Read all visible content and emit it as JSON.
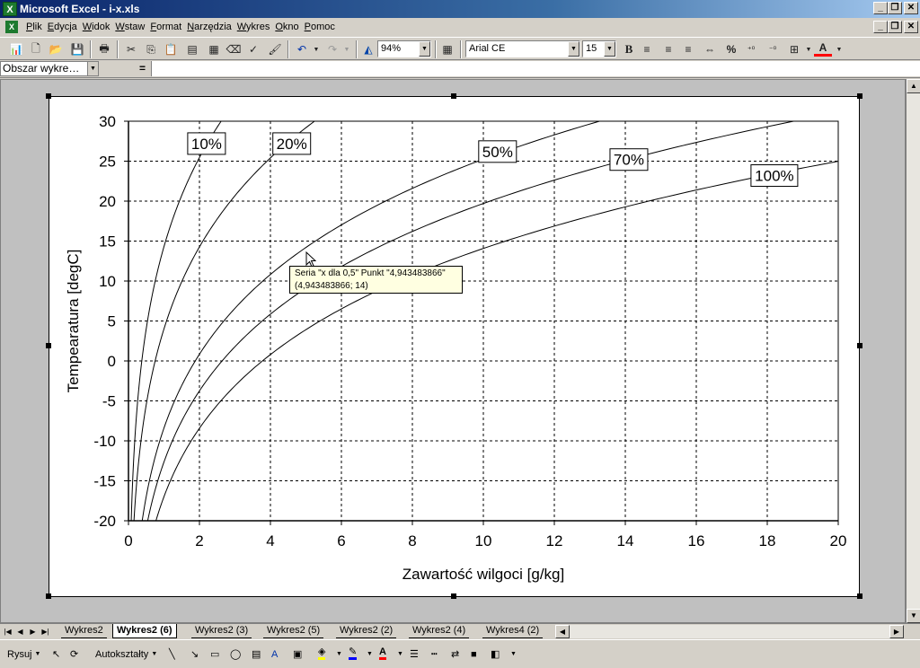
{
  "window": {
    "title": "Microsoft Excel - i-x.xls",
    "app_icon": "X"
  },
  "menu": [
    {
      "key": "P",
      "rest": "lik"
    },
    {
      "key": "E",
      "rest": "dycja"
    },
    {
      "key": "W",
      "rest": "idok"
    },
    {
      "key": "W",
      "rest": "staw"
    },
    {
      "key": "F",
      "rest": "ormat"
    },
    {
      "key": "N",
      "rest": "arzędzia"
    },
    {
      "key": "W",
      "rest": "ykres"
    },
    {
      "key": "O",
      "rest": "kno"
    },
    {
      "key": "P",
      "rest": "omoc"
    }
  ],
  "toolbar": {
    "zoom": "94%",
    "font_name": "Arial CE",
    "font_size": "15",
    "bold_label": "B",
    "percent_label": "%",
    "font_color": "#ff0000"
  },
  "formula_bar": {
    "name_box": "Obszar wykre…",
    "equals": "="
  },
  "tooltip": {
    "line1": "Seria \"x dla 0,5\" Punkt \"4,943483866\"",
    "line2": "(4,943483866; 14)"
  },
  "sheet_tabs": [
    "Wykres2",
    "Wykres2 (6)",
    "Wykres2 (3)",
    "Wykres2 (5)",
    "Wykres2 (2)",
    "Wykres2 (4)",
    "Wykres4 (2)"
  ],
  "active_tab": 1,
  "drawing": {
    "draw_label": "Rysuj",
    "autoshapes_label": "Autokształty"
  },
  "chart_data": {
    "type": "line",
    "xlabel": "Zawartość wilgoci [g/kg]",
    "ylabel": "Tempearatura [degC]",
    "xlim": [
      0,
      20
    ],
    "ylim": [
      -20,
      30
    ],
    "xticks": [
      0,
      2,
      4,
      6,
      8,
      10,
      12,
      14,
      16,
      18,
      20
    ],
    "yticks": [
      -20,
      -15,
      -10,
      -5,
      0,
      5,
      10,
      15,
      20,
      25,
      30
    ],
    "grid": true,
    "temperatures": [
      -20,
      -15,
      -10,
      -5,
      0,
      5,
      10,
      15,
      20,
      25,
      30
    ],
    "series": [
      {
        "label": "10%",
        "rh": 0.1,
        "x": [
          0.064,
          0.103,
          0.161,
          0.248,
          0.377,
          0.542,
          0.766,
          1.066,
          1.466,
          1.985,
          2.663
        ]
      },
      {
        "label": "20%",
        "rh": 0.2,
        "x": [
          0.128,
          0.205,
          0.321,
          0.495,
          0.754,
          1.085,
          1.535,
          2.137,
          2.941,
          3.989,
          5.365
        ]
      },
      {
        "label": "50%",
        "rh": 0.5,
        "x": [
          0.32,
          0.513,
          0.804,
          1.24,
          1.888,
          2.725,
          3.862,
          5.398,
          7.473,
          10.22,
          13.91
        ]
      },
      {
        "label": "70%",
        "rh": 0.7,
        "x": [
          0.448,
          0.719,
          1.126,
          1.737,
          2.646,
          3.823,
          5.425,
          7.595,
          10.55,
          14.49,
          19.88
        ]
      },
      {
        "label": "100%",
        "rh": 1.0,
        "x": [
          0.64,
          1.027,
          1.61,
          2.485,
          3.789,
          5.48,
          7.794,
          10.95,
          15.27,
          21.14,
          29.32
        ]
      }
    ],
    "label_boxes": [
      {
        "text": "10%",
        "x": 2.2,
        "y": 27.2
      },
      {
        "text": "20%",
        "x": 4.6,
        "y": 27.2
      },
      {
        "text": "50%",
        "x": 10.4,
        "y": 26.2
      },
      {
        "text": "70%",
        "x": 14.1,
        "y": 25.2
      },
      {
        "text": "100%",
        "x": 18.2,
        "y": 23.2
      }
    ]
  }
}
